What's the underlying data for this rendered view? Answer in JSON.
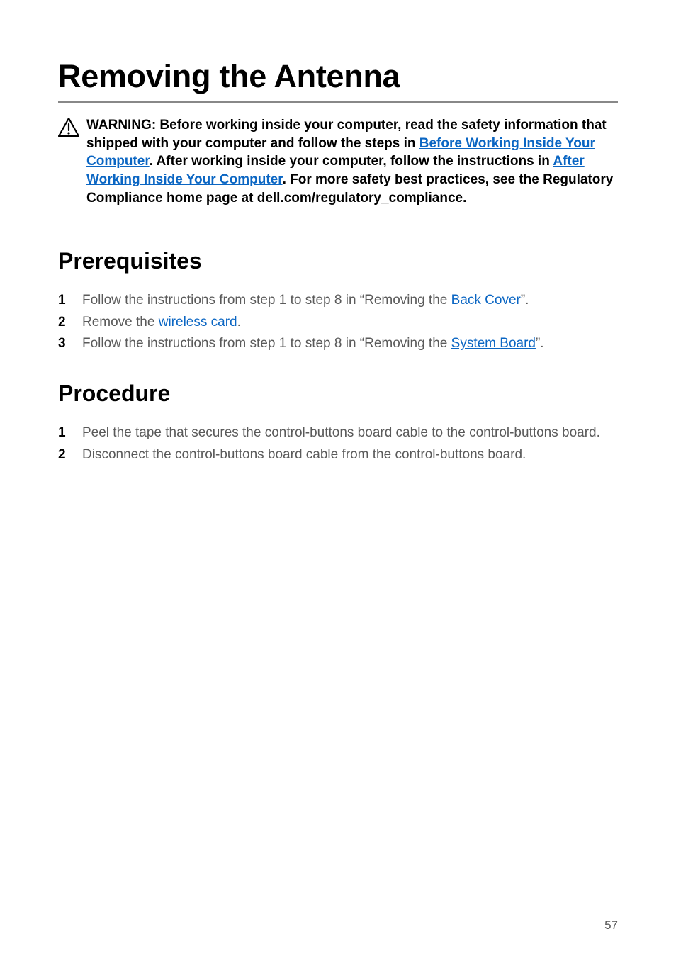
{
  "title": "Removing the Antenna",
  "warning": {
    "p1a": "WARNING: Before working inside your computer, read the safety information that shipped with your computer and follow the steps in ",
    "link1": "Before Working Inside Your Computer",
    "p1b": ". After working inside your computer, follow the instructions in ",
    "link2": "After Working Inside Your Computer",
    "p1c": ". For more safety best practices, see the Regulatory Compliance home page at dell.com/regulatory_compliance."
  },
  "sections": {
    "prereq_title": "Prerequisites",
    "procedure_title": "Procedure"
  },
  "prereq": {
    "n1": "1",
    "s1a": "Follow the instructions from step 1 to step 8 in “Removing the ",
    "s1link": "Back Cover",
    "s1b": "”.",
    "n2": "2",
    "s2a": "Remove the ",
    "s2link": "wireless card",
    "s2b": ".",
    "n3": "3",
    "s3a": "Follow the instructions from step 1 to step 8 in “Removing the ",
    "s3link": "System Board",
    "s3b": "”."
  },
  "procedure": {
    "n1": "1",
    "s1": "Peel the tape that secures the control-buttons board cable to the control-buttons board.",
    "n2": "2",
    "s2": "Disconnect the control-buttons board cable from the control-buttons board."
  },
  "page_number": "57"
}
